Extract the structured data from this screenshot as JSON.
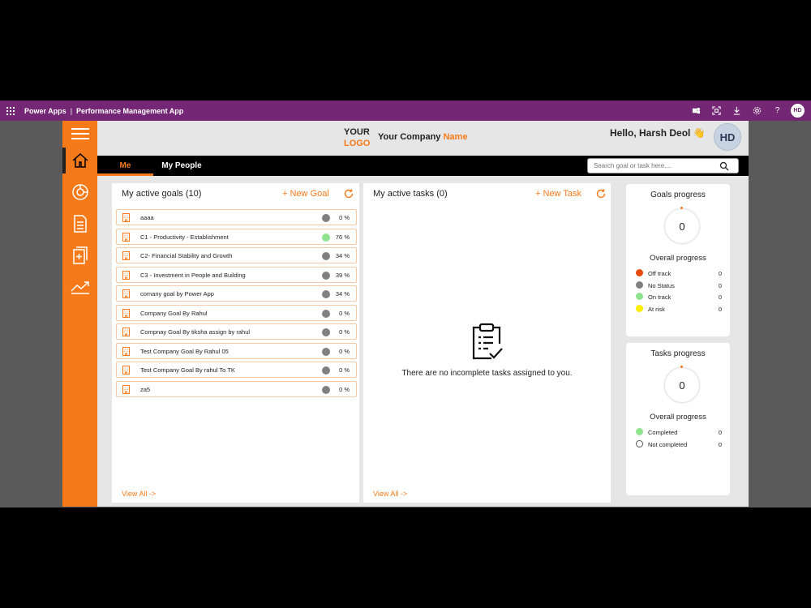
{
  "powerapps_bar": {
    "brand": "Power Apps",
    "separator": "|",
    "app_name": "Performance Management App",
    "user_initials": "HD",
    "icons": [
      "teams-icon",
      "fit-screen-icon",
      "download-icon",
      "settings-icon",
      "help-icon"
    ]
  },
  "header": {
    "logo_line1": "YOUR",
    "logo_line2": "LOGO",
    "company_prefix": "Your Company ",
    "company_accent": "Name",
    "greeting": "Hello, Harsh Deol 👋",
    "avatar_initials": "HD"
  },
  "tabs": {
    "me": "Me",
    "my_people": "My People"
  },
  "search": {
    "placeholder": "Search goal or task here...."
  },
  "goals_card": {
    "title": "My active goals (10)",
    "new_label": "+ New Goal",
    "view_all": "View All ->",
    "items": [
      {
        "name": "aaaa",
        "pct": "0 %",
        "status": "No Status"
      },
      {
        "name": "C1 - Productivity - Establishment",
        "pct": "76 %",
        "status": "On track"
      },
      {
        "name": "C2- Financial Stability and Growth",
        "pct": "34 %",
        "status": "No Status"
      },
      {
        "name": "C3 - Investment in People and Building",
        "pct": "39 %",
        "status": "No Status"
      },
      {
        "name": "comany goal by Power App",
        "pct": "34 %",
        "status": "No Status"
      },
      {
        "name": "Company Goal By Rahul",
        "pct": "0 %",
        "status": "No Status"
      },
      {
        "name": "Compnay Goal By tiksha  assign by rahul",
        "pct": "0 %",
        "status": "No Status"
      },
      {
        "name": "Test Company Goal By Rahul 05",
        "pct": "0 %",
        "status": "No Status"
      },
      {
        "name": "Test Company Goal By rahul To TK",
        "pct": "0 %",
        "status": "No Status"
      },
      {
        "name": "za5",
        "pct": "0 %",
        "status": "No Status"
      }
    ]
  },
  "tasks_card": {
    "title": "My active tasks (0)",
    "new_label": "+ New Task",
    "empty_text": "There are no incomplete tasks assigned to you.",
    "view_all": "View All ->"
  },
  "goals_progress": {
    "title": "Goals progress",
    "value": "0",
    "overall_label": "Overall progress",
    "legend": [
      {
        "label": "Off track",
        "count": "0",
        "color": "#e8490f"
      },
      {
        "label": "No Status",
        "count": "0",
        "color": "#808080"
      },
      {
        "label": "On track",
        "count": "0",
        "color": "#8fe38f"
      },
      {
        "label": "At risk",
        "count": "0",
        "color": "#ffee00"
      }
    ]
  },
  "tasks_progress": {
    "title": "Tasks progress",
    "value": "0",
    "overall_label": "Overall progress",
    "legend": [
      {
        "label": "Completed",
        "count": "0",
        "color": "#8fe38f"
      },
      {
        "label": "Not completed",
        "count": "0",
        "color": "#ffffff"
      }
    ]
  },
  "colors": {
    "accent": "#f77a1a",
    "powerapps_purple": "#742774",
    "status_no_status": "#808080",
    "status_on_track": "#8fe38f"
  },
  "rail_icons": [
    "home-icon",
    "dashboard-icon",
    "document-icon",
    "add-document-icon",
    "trend-chart-icon"
  ]
}
